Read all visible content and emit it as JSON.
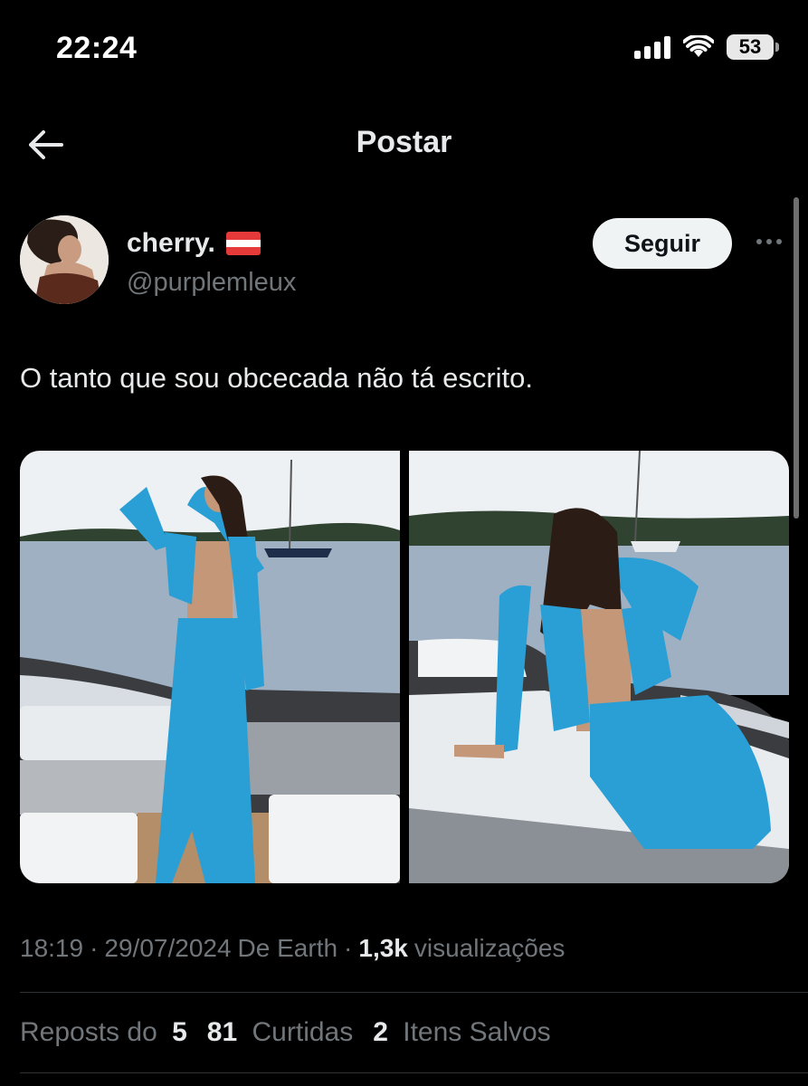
{
  "status_bar": {
    "time": "22:24",
    "battery": "53"
  },
  "nav": {
    "title": "Postar",
    "back_icon": "arrow-left-icon"
  },
  "post": {
    "display_name": "cherry.",
    "handle": "@purplemleux",
    "follow_label": "Seguir",
    "text": "O tanto que sou obcecada não tá escrito.",
    "time": "18:19",
    "sep1": "·",
    "date": "29/07/2024",
    "source": "De Earth",
    "sep2": "·",
    "views_count": "1,3k",
    "views_label": "visualizações",
    "reposts_label": "Reposts do",
    "reposts_count": "5",
    "likes_count": "81",
    "likes_label": "Curtidas",
    "saves_count": "2",
    "saves_label": "Itens Salvos"
  },
  "colors": {
    "background": "#000000",
    "text_primary": "#e7e9ea",
    "text_secondary": "#71767b",
    "follow_button": "#eff3f4",
    "flag_red": "#e63a3a",
    "flag_white": "#ffffff",
    "dress_blue": "#2a9fd6"
  }
}
